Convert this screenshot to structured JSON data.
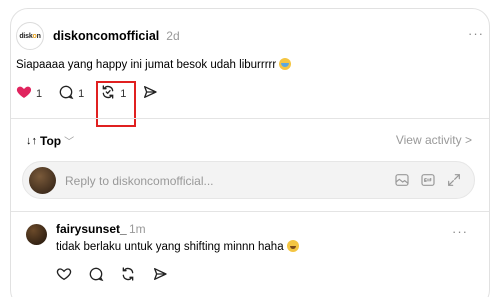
{
  "post": {
    "author": "diskoncomofficial",
    "avatar_text": {
      "a": "disk",
      "o": "o",
      "n": "n"
    },
    "timestamp": "2d",
    "more": "···",
    "text": "Siapaaaa yang happy ini jumat besok udah liburrrrr",
    "emoji": "loudly-crying-face",
    "likes": "1",
    "replies": "1",
    "reposts": "1"
  },
  "sort": {
    "label": "Top",
    "arrow": "↓↑",
    "chevron": "﹀"
  },
  "view_activity": "View activity >",
  "reply": {
    "placeholder": "Reply to diskoncomofficial..."
  },
  "comment": {
    "author": "fairysunset_",
    "timestamp": "1m",
    "more": "···",
    "text": "tidak berlaku untuk yang shifting minnn haha",
    "emoji": "grinning-squinting-face"
  },
  "colors": {
    "like": "#e0245e",
    "highlight": "#e02020",
    "muted": "#999999"
  }
}
